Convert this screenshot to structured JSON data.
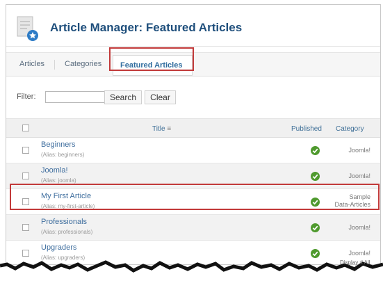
{
  "header": {
    "title": "Article Manager: Featured Articles",
    "icon": "featured-article-icon"
  },
  "tabs": [
    {
      "label": "Articles",
      "active": false
    },
    {
      "label": "Categories",
      "active": false
    },
    {
      "label": "Featured Articles",
      "active": true
    }
  ],
  "filter": {
    "label": "Filter:",
    "value": "",
    "search_label": "Search",
    "clear_label": "Clear"
  },
  "table": {
    "columns": {
      "title": "Title",
      "published": "Published",
      "category": "Category"
    },
    "rows": [
      {
        "title": "Beginners",
        "alias": "(Alias: beginners)",
        "category": "Joomla!",
        "published": true
      },
      {
        "title": "Joomla!",
        "alias": "(Alias: joomla)",
        "category": "Joomla!",
        "published": true
      },
      {
        "title": "My First Article",
        "alias": "(Alias: my-first-article)",
        "category_line1": "Sample",
        "category_line2": "Data-Articles",
        "published": true
      },
      {
        "title": "Professionals",
        "alias": "(Alias: professionals)",
        "category": "Joomla!",
        "published": true
      },
      {
        "title": "Upgraders",
        "alias": "(Alias: upgraders)",
        "category": "Joomla!",
        "published": true
      }
    ]
  },
  "footer": {
    "display_text": "Display # All"
  },
  "colors": {
    "title": "#1f4f7c",
    "link": "#3f6e9e",
    "highlight": "#c23a3a",
    "published": "#4f9a2e"
  }
}
